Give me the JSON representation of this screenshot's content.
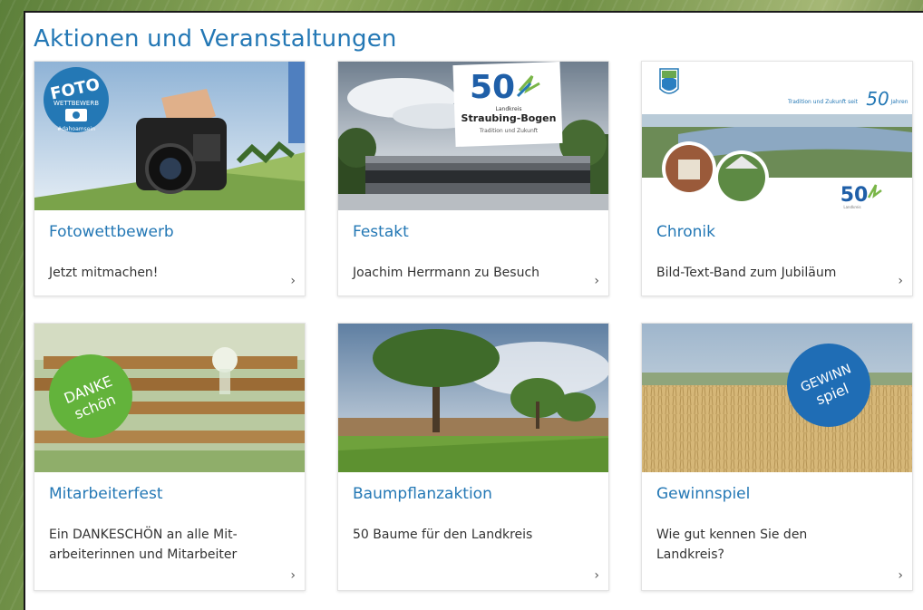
{
  "section": {
    "title": "Aktionen und Veranstaltungen"
  },
  "cards": [
    {
      "title": "Fotowettbewerb",
      "text": "Jetzt mitmachen!",
      "badge": "FOTO",
      "badge_small": "WETTBEWERB",
      "badge_tag": "#dahoamsein",
      "arrow": "›"
    },
    {
      "title": "Festakt",
      "text": "Joachim Herrmann zu Besuch",
      "logo_number": "50",
      "logo_line1": "Landkreis",
      "logo_name": "Straubing-Bogen",
      "logo_tagline": "Tradition und Zukunft",
      "arrow": "›"
    },
    {
      "title": "Chronik",
      "text": "Bild-Text-Band zum Jubiläum",
      "banner_text": "Tradition und Zukunft seit",
      "banner_number": "50",
      "banner_unit": "Jahren",
      "logo_number": "50",
      "logo_sub": "Landkreis",
      "arrow": "›"
    },
    {
      "title": "Mitarbeiterfest",
      "text": "Ein DANKESCHÖN an alle Mit-arbeiterinnen und Mitarbeiter",
      "badge_line1": "DANKE",
      "badge_line2": "schön",
      "arrow": "›"
    },
    {
      "title": "Baumpflanzaktion",
      "text": "50 Baume für den Landkreis",
      "arrow": "›"
    },
    {
      "title": "Gewinnspiel",
      "text": "Wie gut kennen Sie den Landkreis?",
      "badge_line1": "GEWINN",
      "badge_line2": "spiel",
      "arrow": "›"
    }
  ],
  "colors": {
    "accent_blue": "#2478b5",
    "badge_green": "#63b33b",
    "badge_blue": "#1f6db5"
  }
}
